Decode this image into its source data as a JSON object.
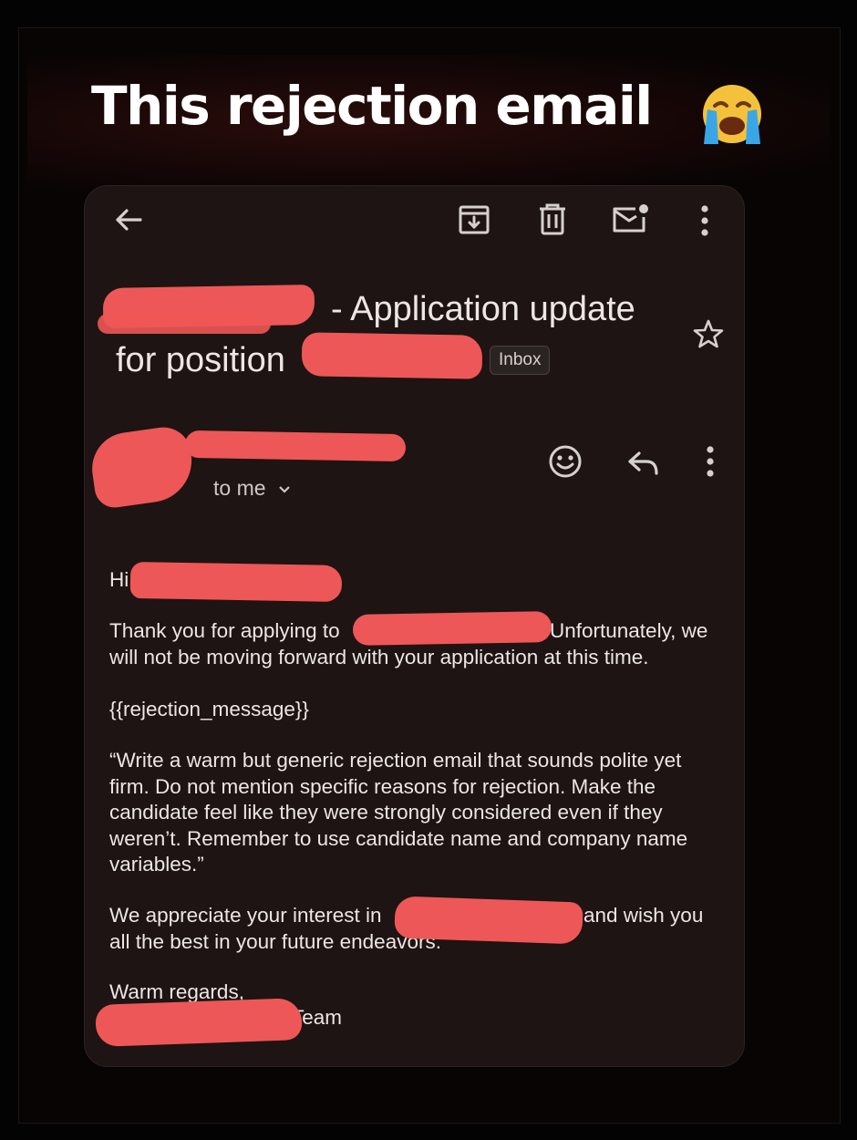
{
  "post": {
    "headline": "This rejection email",
    "emoji": "loudly-crying-face"
  },
  "toolbar": {
    "back_icon": "arrow-left-icon",
    "archive_icon": "archive-icon",
    "delete_icon": "trash-icon",
    "mark_unread_icon": "mark-unread-icon",
    "more_icon": "more-vert-icon"
  },
  "email": {
    "subject_line1": "- Application update",
    "subject_line2": "for position",
    "label": "Inbox",
    "recipient": "to me",
    "greeting": "Hi",
    "paragraph1_start": "Thank you for applying to",
    "paragraph1_end": "Unfortunately, we",
    "paragraph1_line2": "will not be moving forward with your application at this time.",
    "template_variable": "{{rejection_message}}",
    "prompt_quote": "“Write a warm but generic rejection email that sounds polite yet firm. Do not mention specific reasons for rejection. Make the candidate feel like they were strongly considered even if they weren’t. Remember to use candidate name and company name variables.”",
    "closing_start": "We appreciate your interest in",
    "closing_end": "and wish you",
    "closing_line2": "all the best in your future endeavors.",
    "signoff": "Warm regards,",
    "signature_suffix": "Team"
  },
  "colors": {
    "background": "#1d1413",
    "text": "#ece6e4",
    "redaction": "#ee5757"
  }
}
